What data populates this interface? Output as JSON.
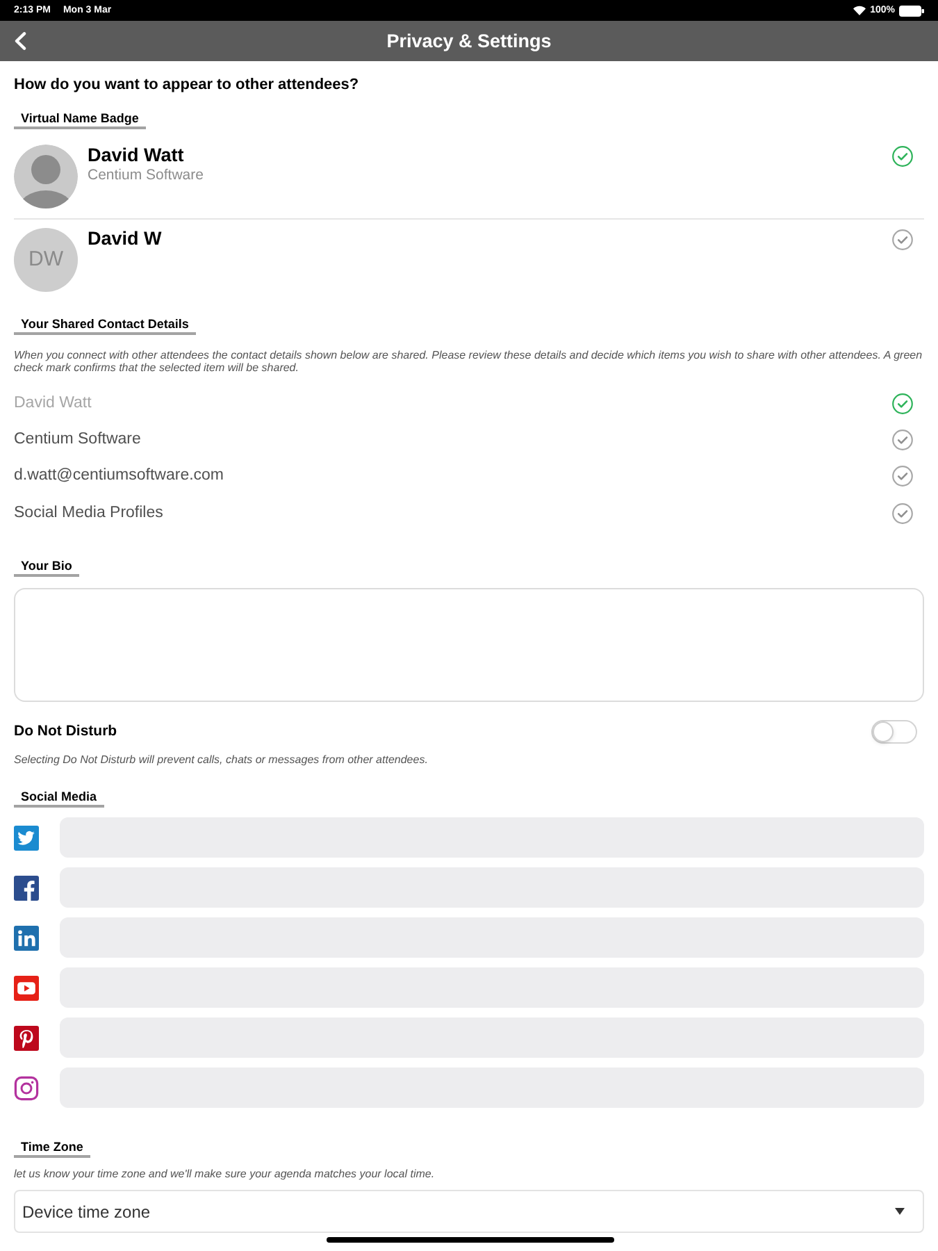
{
  "status_bar": {
    "time": "2:13 PM",
    "date": "Mon 3 Mar",
    "battery": "100%"
  },
  "header": {
    "title": "Privacy & Settings"
  },
  "name_badge": {
    "question": "How do you want to appear to other attendees?",
    "heading": "Virtual Name Badge",
    "options": [
      {
        "kind": "photo",
        "name": "David Watt",
        "company": "Centium Software",
        "selected": true
      },
      {
        "kind": "initials",
        "initials": "DW",
        "name": "David W",
        "selected": false
      }
    ]
  },
  "shared_contact_details": {
    "heading": "Your Shared Contact Details",
    "description": "When you connect with other attendees the contact details shown below are shared. Please review these details and decide which items you wish to share with other attendees. A green check mark confirms that the selected item will be shared.",
    "items": [
      {
        "label": "David Watt",
        "disabled": true,
        "selected": true
      },
      {
        "label": "Centium Software",
        "disabled": false,
        "selected": false
      },
      {
        "label": "d.watt@centiumsoftware.com",
        "disabled": false,
        "selected": false
      },
      {
        "label": "Social Media Profiles",
        "disabled": false,
        "selected": false
      }
    ]
  },
  "bio": {
    "heading": "Your Bio"
  },
  "do_not_disturb": {
    "label": "Do Not Disturb",
    "on": false,
    "description": "Selecting Do Not Disturb will prevent calls, chats or messages from other attendees."
  },
  "social_media": {
    "heading": "Social Media",
    "profiles": [
      {
        "kind": "twitter"
      },
      {
        "kind": "facebook"
      },
      {
        "kind": "linkedin"
      },
      {
        "kind": "youtube"
      },
      {
        "kind": "pinterest"
      },
      {
        "kind": "instagram"
      }
    ]
  },
  "time_zone": {
    "heading": "Time Zone",
    "description": "let us know your time zone and we'll make sure your agenda matches your local time.",
    "value": "Device time zone"
  }
}
